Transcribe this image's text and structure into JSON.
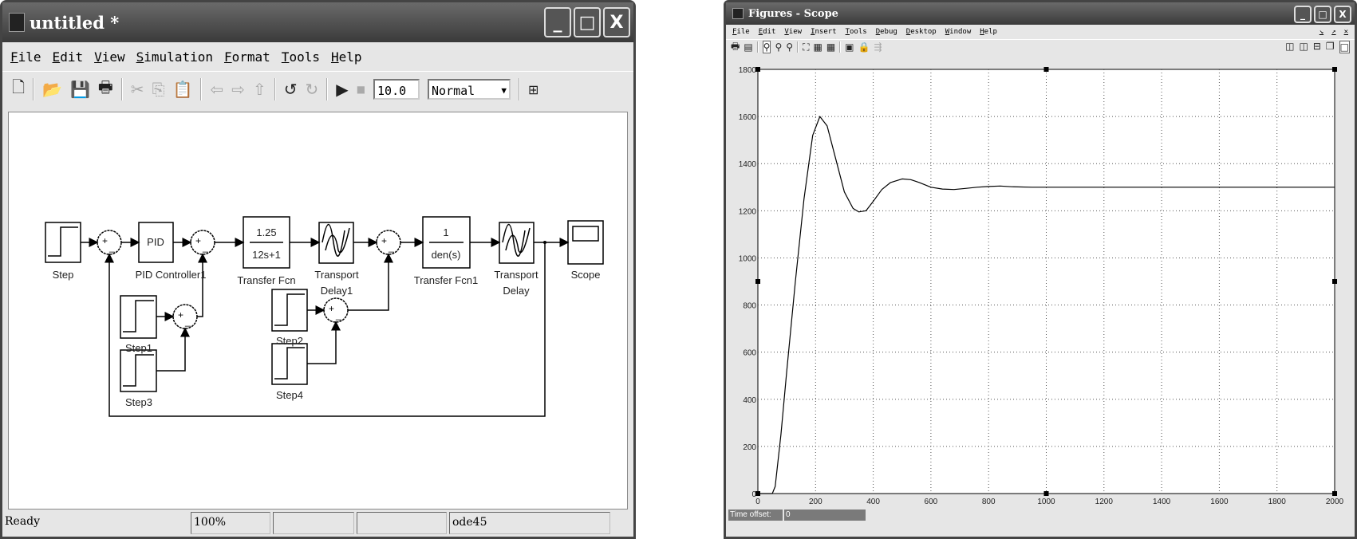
{
  "simulink": {
    "title": "untitled *",
    "menu": [
      "File",
      "Edit",
      "View",
      "Simulation",
      "Format",
      "Tools",
      "Help"
    ],
    "stop_time": "10.0",
    "sim_mode": "Normal",
    "status": {
      "state": "Ready",
      "zoom": "100%",
      "solver": "ode45"
    },
    "blocks": {
      "step": "Step",
      "pid_text": "PID",
      "pid": "PID Controller1",
      "tf_num": "1.25",
      "tf_den": "12s+1",
      "tf": "Transfer Fcn",
      "td1_a": "Transport",
      "td1_b": "Delay1",
      "tf1_num": "1",
      "tf1_den": "den(s)",
      "tf1": "Transfer Fcn1",
      "td_a": "Transport",
      "td_b": "Delay",
      "scope": "Scope",
      "step1": "Step1",
      "step2": "Step2",
      "step3": "Step3",
      "step4": "Step4",
      "plus": "+",
      "minus": "_"
    }
  },
  "scope": {
    "title": "Figures - Scope",
    "menu": [
      "File",
      "Edit",
      "View",
      "Insert",
      "Tools",
      "Debug",
      "Desktop",
      "Window",
      "Help"
    ],
    "time_offset_label": "Time offset:",
    "time_offset_value": "0"
  },
  "chart_data": {
    "type": "line",
    "xlim": [
      0,
      2000
    ],
    "ylim": [
      0,
      1800
    ],
    "xticks": [
      0,
      200,
      400,
      600,
      800,
      1000,
      1200,
      1400,
      1600,
      1800,
      2000
    ],
    "yticks": [
      0,
      200,
      400,
      600,
      800,
      1000,
      1200,
      1400,
      1600,
      1800
    ],
    "grid": true,
    "series": [
      {
        "x": [
          0,
          50,
          60,
          80,
          100,
          130,
          160,
          190,
          215,
          240,
          270,
          300,
          330,
          350,
          375,
          400,
          430,
          460,
          500,
          530,
          560,
          600,
          640,
          680,
          720,
          760,
          800,
          840,
          880,
          950,
          1050,
          1200,
          1400,
          1600,
          1800,
          2000
        ],
        "y": [
          0,
          0,
          30,
          250,
          520,
          900,
          1250,
          1520,
          1600,
          1560,
          1420,
          1280,
          1210,
          1195,
          1200,
          1240,
          1290,
          1320,
          1335,
          1332,
          1320,
          1300,
          1292,
          1290,
          1295,
          1300,
          1303,
          1305,
          1302,
          1300,
          1300,
          1300,
          1300,
          1300,
          1300,
          1300
        ]
      }
    ]
  }
}
